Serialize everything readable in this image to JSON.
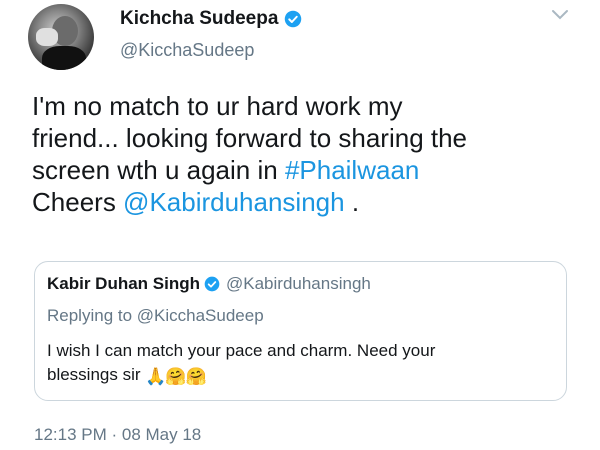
{
  "author": {
    "display_name": "Kichcha Sudeepa",
    "handle": "@KicchaSudeep",
    "verified_icon": "verified-badge"
  },
  "tweet": {
    "text_lines": [
      "I'm no match to ur hard work my",
      "friend... looking forward to sharing the",
      "screen wth u again in "
    ],
    "hashtag": "#Phailwaan",
    "cheers_prefix": "Cheers ",
    "mention": "@Kabirduhansingh",
    "suffix": " ."
  },
  "quoted_tweet": {
    "display_name": "Kabir Duhan Singh",
    "handle": "@Kabirduhansingh",
    "replying_to": "Replying to @KicchaSudeep",
    "text_line1": "I wish I can match your pace and charm. Need your",
    "text_line2": "blessings sir ",
    "emojis": "🙏🤗🤗"
  },
  "timestamp": "12:13 PM · 08 May 18",
  "colors": {
    "link": "#1b95e0",
    "secondary_text": "#657786",
    "border": "#ccd6dd"
  },
  "icons": [
    "avatar-photo",
    "verified-badge",
    "chevron-down-icon",
    "folded-hands-emoji",
    "hugging-face-emoji"
  ]
}
